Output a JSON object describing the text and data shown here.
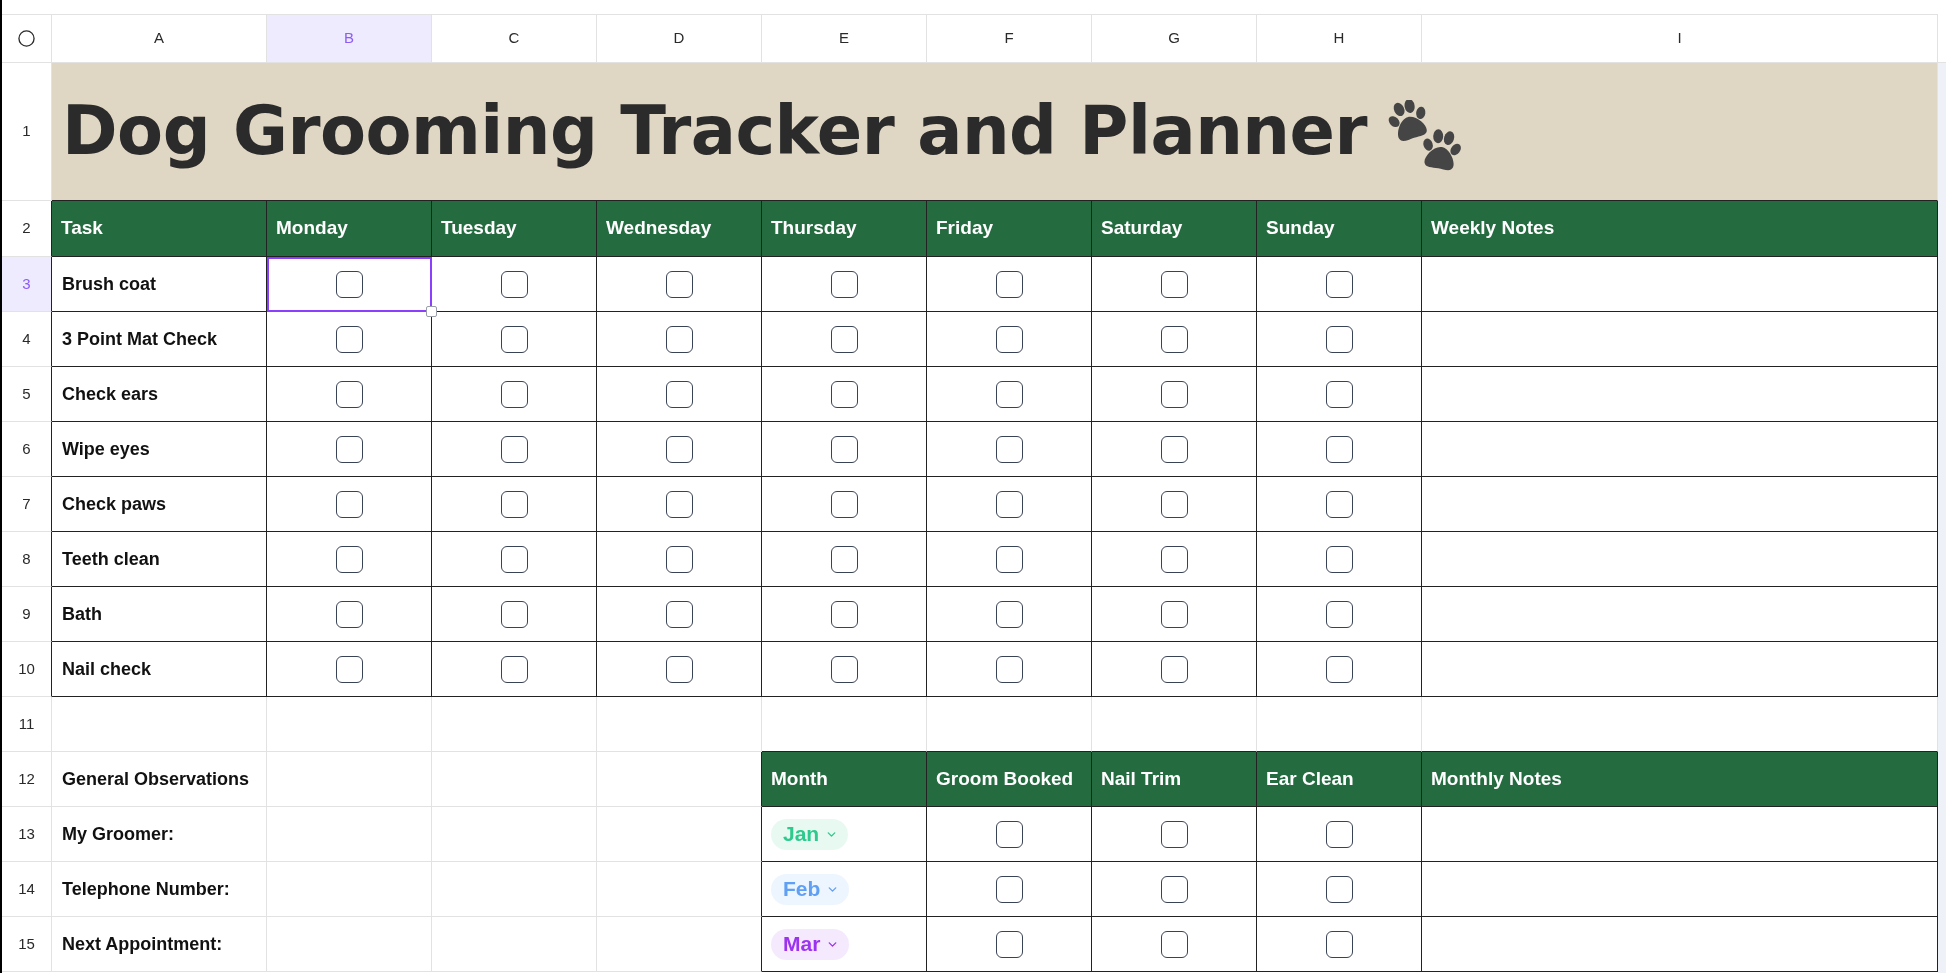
{
  "sheet": {
    "column_letters": [
      {
        "label": "A",
        "selected": false
      },
      {
        "label": "B",
        "selected": true
      },
      {
        "label": "C",
        "selected": false
      },
      {
        "label": "D",
        "selected": false
      },
      {
        "label": "E",
        "selected": false
      },
      {
        "label": "F",
        "selected": false
      },
      {
        "label": "G",
        "selected": false
      },
      {
        "label": "H",
        "selected": false
      },
      {
        "label": "I",
        "selected": false
      }
    ],
    "row_numbers": [
      {
        "label": "1",
        "selected": false
      },
      {
        "label": "2",
        "selected": false
      },
      {
        "label": "3",
        "selected": true
      },
      {
        "label": "4",
        "selected": false
      },
      {
        "label": "5",
        "selected": false
      },
      {
        "label": "6",
        "selected": false
      },
      {
        "label": "7",
        "selected": false
      },
      {
        "label": "8",
        "selected": false
      },
      {
        "label": "9",
        "selected": false
      },
      {
        "label": "10",
        "selected": false
      },
      {
        "label": "11",
        "selected": false
      },
      {
        "label": "12",
        "selected": false
      },
      {
        "label": "13",
        "selected": false
      },
      {
        "label": "14",
        "selected": false
      },
      {
        "label": "15",
        "selected": false
      }
    ]
  },
  "title": "Dog Grooming Tracker and Planner",
  "weekly_tracker": {
    "columns": [
      "Task",
      "Monday",
      "Tuesday",
      "Wednesday",
      "Thursday",
      "Friday",
      "Saturday",
      "Sunday",
      "Weekly Notes"
    ],
    "rows": [
      {
        "task": "Brush coat",
        "days": [
          {
            "checked": false,
            "selected": true
          },
          {
            "checked": false,
            "selected": false
          },
          {
            "checked": false,
            "selected": false
          },
          {
            "checked": false,
            "selected": false
          },
          {
            "checked": false,
            "selected": false
          },
          {
            "checked": false,
            "selected": false
          },
          {
            "checked": false,
            "selected": false
          }
        ]
      },
      {
        "task": "3 Point Mat Check",
        "days": [
          {
            "checked": false,
            "selected": false
          },
          {
            "checked": false,
            "selected": false
          },
          {
            "checked": false,
            "selected": false
          },
          {
            "checked": false,
            "selected": false
          },
          {
            "checked": false,
            "selected": false
          },
          {
            "checked": false,
            "selected": false
          },
          {
            "checked": false,
            "selected": false
          }
        ]
      },
      {
        "task": "Check ears",
        "days": [
          {
            "checked": false,
            "selected": false
          },
          {
            "checked": false,
            "selected": false
          },
          {
            "checked": false,
            "selected": false
          },
          {
            "checked": false,
            "selected": false
          },
          {
            "checked": false,
            "selected": false
          },
          {
            "checked": false,
            "selected": false
          },
          {
            "checked": false,
            "selected": false
          }
        ]
      },
      {
        "task": "Wipe eyes",
        "days": [
          {
            "checked": false,
            "selected": false
          },
          {
            "checked": false,
            "selected": false
          },
          {
            "checked": false,
            "selected": false
          },
          {
            "checked": false,
            "selected": false
          },
          {
            "checked": false,
            "selected": false
          },
          {
            "checked": false,
            "selected": false
          },
          {
            "checked": false,
            "selected": false
          }
        ]
      },
      {
        "task": "Check paws",
        "days": [
          {
            "checked": false,
            "selected": false
          },
          {
            "checked": false,
            "selected": false
          },
          {
            "checked": false,
            "selected": false
          },
          {
            "checked": false,
            "selected": false
          },
          {
            "checked": false,
            "selected": false
          },
          {
            "checked": false,
            "selected": false
          },
          {
            "checked": false,
            "selected": false
          }
        ]
      },
      {
        "task": "Teeth clean",
        "days": [
          {
            "checked": false,
            "selected": false
          },
          {
            "checked": false,
            "selected": false
          },
          {
            "checked": false,
            "selected": false
          },
          {
            "checked": false,
            "selected": false
          },
          {
            "checked": false,
            "selected": false
          },
          {
            "checked": false,
            "selected": false
          },
          {
            "checked": false,
            "selected": false
          }
        ]
      },
      {
        "task": "Bath",
        "days": [
          {
            "checked": false,
            "selected": false
          },
          {
            "checked": false,
            "selected": false
          },
          {
            "checked": false,
            "selected": false
          },
          {
            "checked": false,
            "selected": false
          },
          {
            "checked": false,
            "selected": false
          },
          {
            "checked": false,
            "selected": false
          },
          {
            "checked": false,
            "selected": false
          }
        ]
      },
      {
        "task": "Nail check",
        "days": [
          {
            "checked": false,
            "selected": false
          },
          {
            "checked": false,
            "selected": false
          },
          {
            "checked": false,
            "selected": false
          },
          {
            "checked": false,
            "selected": false
          },
          {
            "checked": false,
            "selected": false
          },
          {
            "checked": false,
            "selected": false
          },
          {
            "checked": false,
            "selected": false
          }
        ]
      }
    ]
  },
  "general_observations": {
    "heading": "General Observations",
    "fields": [
      "My Groomer:",
      "Telephone Number:",
      "Next Appointment:"
    ]
  },
  "monthly_tracker": {
    "columns": [
      "Month",
      "Groom Booked",
      "Nail Trim",
      "Ear Clean",
      "Monthly Notes"
    ],
    "rows": [
      {
        "month": "Jan",
        "color": "#2ec98c",
        "checks": [
          {
            "checked": false
          },
          {
            "checked": false
          },
          {
            "checked": false
          }
        ]
      },
      {
        "month": "Feb",
        "color": "#5fa0f4",
        "checks": [
          {
            "checked": false
          },
          {
            "checked": false
          },
          {
            "checked": false
          }
        ]
      },
      {
        "month": "Mar",
        "color": "#9c33ef",
        "checks": [
          {
            "checked": false
          },
          {
            "checked": false
          },
          {
            "checked": false
          }
        ]
      }
    ]
  }
}
